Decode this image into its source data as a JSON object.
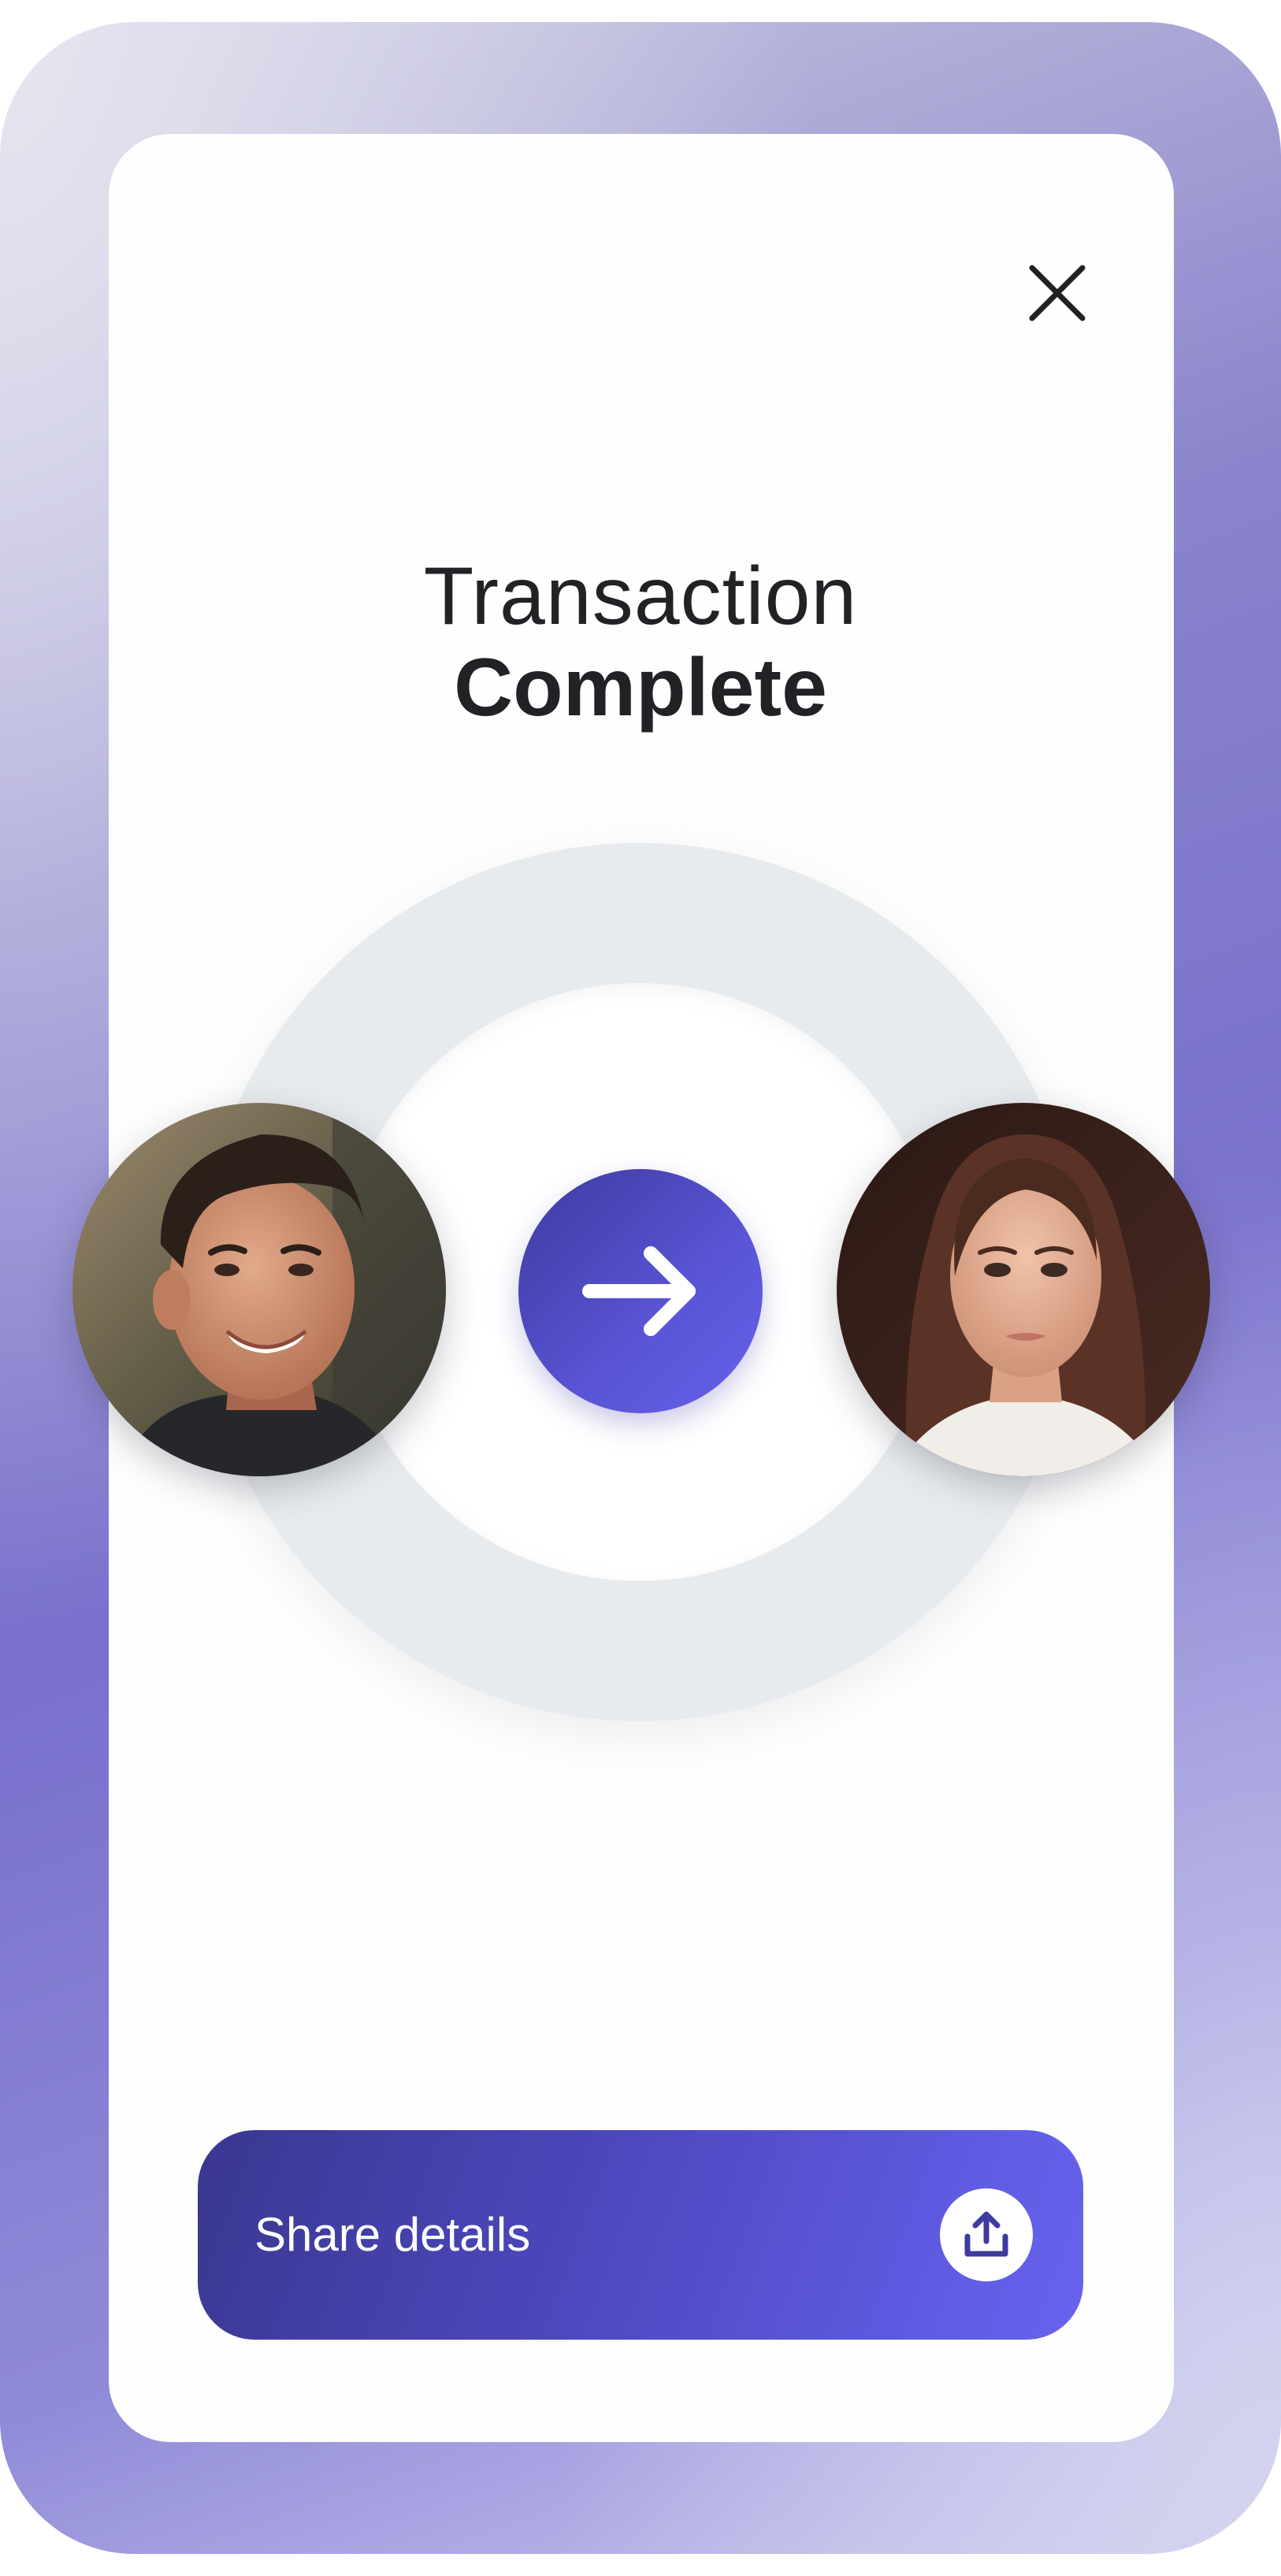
{
  "header": {
    "close_icon": "close-icon"
  },
  "title": {
    "line1": "Transaction",
    "line2": "Complete"
  },
  "transfer": {
    "sender_avatar": "sender-avatar",
    "recipient_avatar": "recipient-avatar",
    "direction_icon": "arrow-right-icon"
  },
  "actions": {
    "share_label": "Share details",
    "share_icon": "upload-share-icon"
  },
  "colors": {
    "accent_dark": "#3e3a9e",
    "accent_light": "#6662ea",
    "title_text": "#222226",
    "ring": "#e8ebee"
  }
}
